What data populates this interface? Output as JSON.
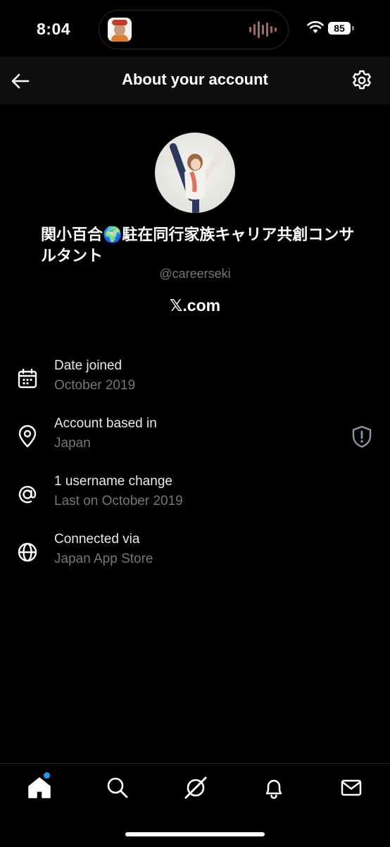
{
  "status_bar": {
    "time": "8:04",
    "battery": "85",
    "icons": [
      "wifi-icon",
      "battery-icon",
      "waveform-icon"
    ]
  },
  "header": {
    "title": "About your account",
    "back_icon": "arrow-left-icon",
    "settings_icon": "gear-icon"
  },
  "profile": {
    "display_name": "関小百合🌍駐在同行家族キャリア共創コンサルタント",
    "handle": "@careerseki",
    "site": "𝕏.com"
  },
  "info_rows": [
    {
      "icon": "calendar-icon",
      "title": "Date joined",
      "subtitle": "October 2019"
    },
    {
      "icon": "location-pin-icon",
      "title": "Account based in",
      "subtitle": "Japan",
      "badge_icon": "shield-alert-icon"
    },
    {
      "icon": "at-sign-icon",
      "title": "1 username change",
      "subtitle": "Last on October 2019"
    },
    {
      "icon": "globe-icon",
      "title": "Connected via",
      "subtitle": "Japan App Store"
    }
  ],
  "bottom_nav": {
    "items": [
      "home-icon",
      "search-icon",
      "grok-icon",
      "bell-icon",
      "mail-icon"
    ],
    "accent_color": "#1d9bf0"
  },
  "colors": {
    "background": "#000000",
    "header_background": "#0f0f0f",
    "primary_text": "#e7e9ea",
    "secondary_text": "#71767b"
  }
}
